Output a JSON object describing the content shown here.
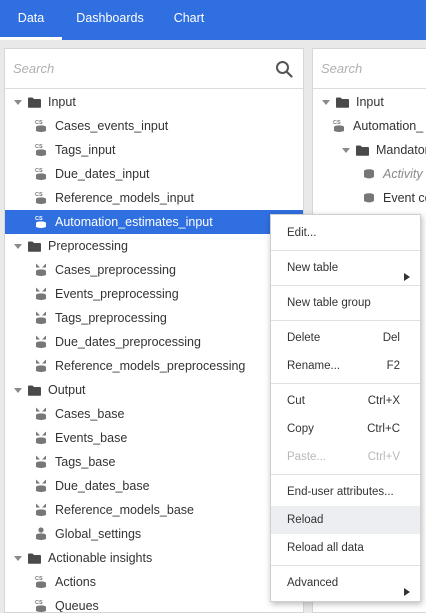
{
  "tabs": [
    {
      "label": "Data",
      "active": true
    },
    {
      "label": "Dashboards",
      "active": false
    },
    {
      "label": "Chart",
      "active": false
    }
  ],
  "left_panel": {
    "search_placeholder": "Search",
    "tree": [
      {
        "label": "Input",
        "type": "folder"
      },
      {
        "label": "Cases_events_input",
        "type": "cs-table"
      },
      {
        "label": "Tags_input",
        "type": "cs-table"
      },
      {
        "label": "Due_dates_input",
        "type": "cs-table"
      },
      {
        "label": "Reference_models_input",
        "type": "cs-table"
      },
      {
        "label": "Automation_estimates_input",
        "type": "cs-table",
        "selected": true
      },
      {
        "label": "Preprocessing",
        "type": "folder"
      },
      {
        "label": "Cases_preprocessing",
        "type": "process-table"
      },
      {
        "label": "Events_preprocessing",
        "type": "process-table"
      },
      {
        "label": "Tags_preprocessing",
        "type": "process-table"
      },
      {
        "label": "Due_dates_preprocessing",
        "type": "process-table"
      },
      {
        "label": "Reference_models_preprocessing",
        "type": "process-table"
      },
      {
        "label": "Output",
        "type": "folder"
      },
      {
        "label": "Cases_base",
        "type": "process-table"
      },
      {
        "label": "Events_base",
        "type": "process-table"
      },
      {
        "label": "Tags_base",
        "type": "process-table"
      },
      {
        "label": "Due_dates_base",
        "type": "process-table"
      },
      {
        "label": "Reference_models_base",
        "type": "process-table"
      },
      {
        "label": "Global_settings",
        "type": "settings-table"
      },
      {
        "label": "Actionable insights",
        "type": "folder"
      },
      {
        "label": "Actions",
        "type": "cs-table"
      },
      {
        "label": "Queues",
        "type": "cs-table"
      }
    ]
  },
  "right_panel": {
    "search_placeholder": "Search",
    "tree": [
      {
        "label": "Input",
        "type": "folder"
      },
      {
        "label": "Automation_",
        "type": "cs-table"
      },
      {
        "label": "Mandatory",
        "type": "folder"
      },
      {
        "label": "Activity",
        "type": "db",
        "italic": true
      },
      {
        "label": "Event co",
        "type": "db"
      }
    ]
  },
  "context_menu": {
    "items": [
      {
        "label": "Edit...",
        "shortcut": ""
      },
      {
        "label": "New table",
        "submenu": true
      },
      {
        "label": "New table group",
        "shortcut": ""
      },
      {
        "label": "Delete",
        "shortcut": "Del"
      },
      {
        "label": "Rename...",
        "shortcut": "F2"
      },
      {
        "label": "Cut",
        "shortcut": "Ctrl+X"
      },
      {
        "label": "Copy",
        "shortcut": "Ctrl+C"
      },
      {
        "label": "Paste...",
        "shortcut": "Ctrl+V",
        "disabled": true
      },
      {
        "label": "End-user attributes...",
        "shortcut": ""
      },
      {
        "label": "Reload",
        "shortcut": "",
        "hover": true
      },
      {
        "label": "Reload all data",
        "shortcut": ""
      },
      {
        "label": "Advanced",
        "submenu": true
      }
    ]
  },
  "colors": {
    "accent": "#2f6fe0",
    "folder": "#4a4a4a",
    "icon": "#777777"
  }
}
